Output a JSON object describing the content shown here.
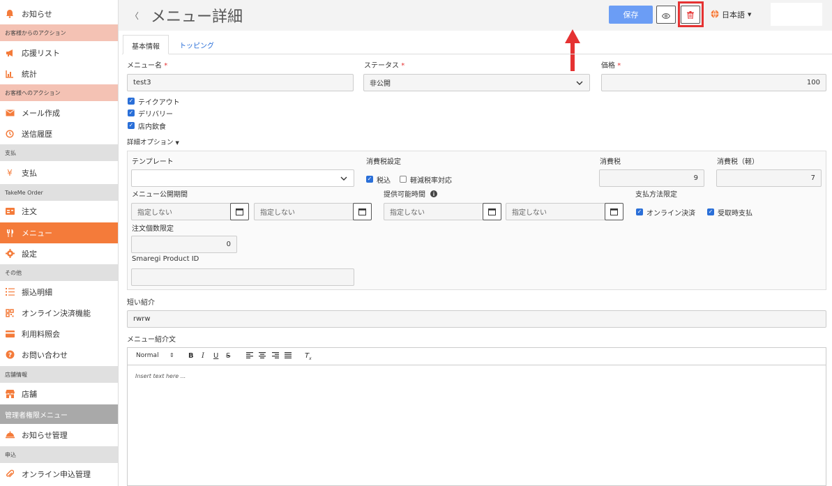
{
  "sidebar": {
    "items": [
      {
        "label": "お知らせ",
        "icon": "bell-icon"
      },
      {
        "section": "お客様からのアクション"
      },
      {
        "label": "応援リスト",
        "icon": "megaphone-icon"
      },
      {
        "label": "統計",
        "icon": "bar-chart-icon"
      },
      {
        "section": "お客様へのアクション"
      },
      {
        "label": "メール作成",
        "icon": "mail-icon"
      },
      {
        "label": "送信履歴",
        "icon": "history-icon"
      },
      {
        "section": "支払"
      },
      {
        "label": "支払",
        "icon": "yen-icon"
      },
      {
        "section": "TakeMe Order"
      },
      {
        "label": "注文",
        "icon": "order-icon"
      },
      {
        "label": "メニュー",
        "icon": "fork-knife-icon"
      },
      {
        "label": "設定",
        "icon": "gear-icon"
      },
      {
        "section": "その他"
      },
      {
        "label": "振込明細",
        "icon": "list-icon"
      },
      {
        "label": "オンライン決済機能",
        "icon": "qr-icon"
      },
      {
        "label": "利用料照会",
        "icon": "card-icon"
      },
      {
        "label": "お問い合わせ",
        "icon": "question-icon"
      },
      {
        "section": "店舗情報"
      },
      {
        "label": "店舗",
        "icon": "store-icon"
      },
      {
        "section": "管理者権限メニュー"
      },
      {
        "label": "お知らせ管理",
        "icon": "service-bell-icon"
      },
      {
        "section": "申込"
      },
      {
        "label": "オンライン申込管理",
        "icon": "paperclip-icon"
      }
    ]
  },
  "header": {
    "back": "〈",
    "title": "メニュー詳細",
    "save": "保存",
    "language": "日本語"
  },
  "tabs": [
    "基本情報",
    "トッピング"
  ],
  "form": {
    "menu_name_label": "メニュー名",
    "menu_name_value": "test3",
    "status_label": "ステータス",
    "status_value": "非公開",
    "price_label": "価格",
    "price_value": "100",
    "required_mark": "*",
    "takeout": "テイクアウト",
    "delivery": "デリバリー",
    "eat_in": "店内飲食",
    "detail_options": "詳細オプション",
    "template_label": "テンプレート",
    "tax_setting_label": "消費税設定",
    "tax_included": "税込",
    "reduced_rate": "軽減税率対応",
    "tax_label": "消費税",
    "tax_value": "9",
    "tax_light_label": "消費税（軽）",
    "tax_light_value": "7",
    "publish_period_label": "メニュー公開期間",
    "unspecified": "指定しない",
    "available_time_label": "提供可能時間",
    "payment_limit_label": "支払方法限定",
    "online_payment": "オンライン決済",
    "pay_on_pickup": "受取時支払",
    "order_limit_label": "注文個数限定",
    "order_limit_value": "0",
    "smaregi_label": "Smaregi Product ID",
    "smaregi_value": "",
    "short_intro_label": "短い紹介",
    "short_intro_value": "rwrw",
    "intro_label": "メニュー紹介文",
    "editor_format": "Normal",
    "editor_placeholder": "Insert text here ..."
  },
  "colors": {
    "accent": "#f47b3a",
    "primary": "#6b9df5",
    "link": "#2a6fd8",
    "highlight": "#e53232"
  }
}
